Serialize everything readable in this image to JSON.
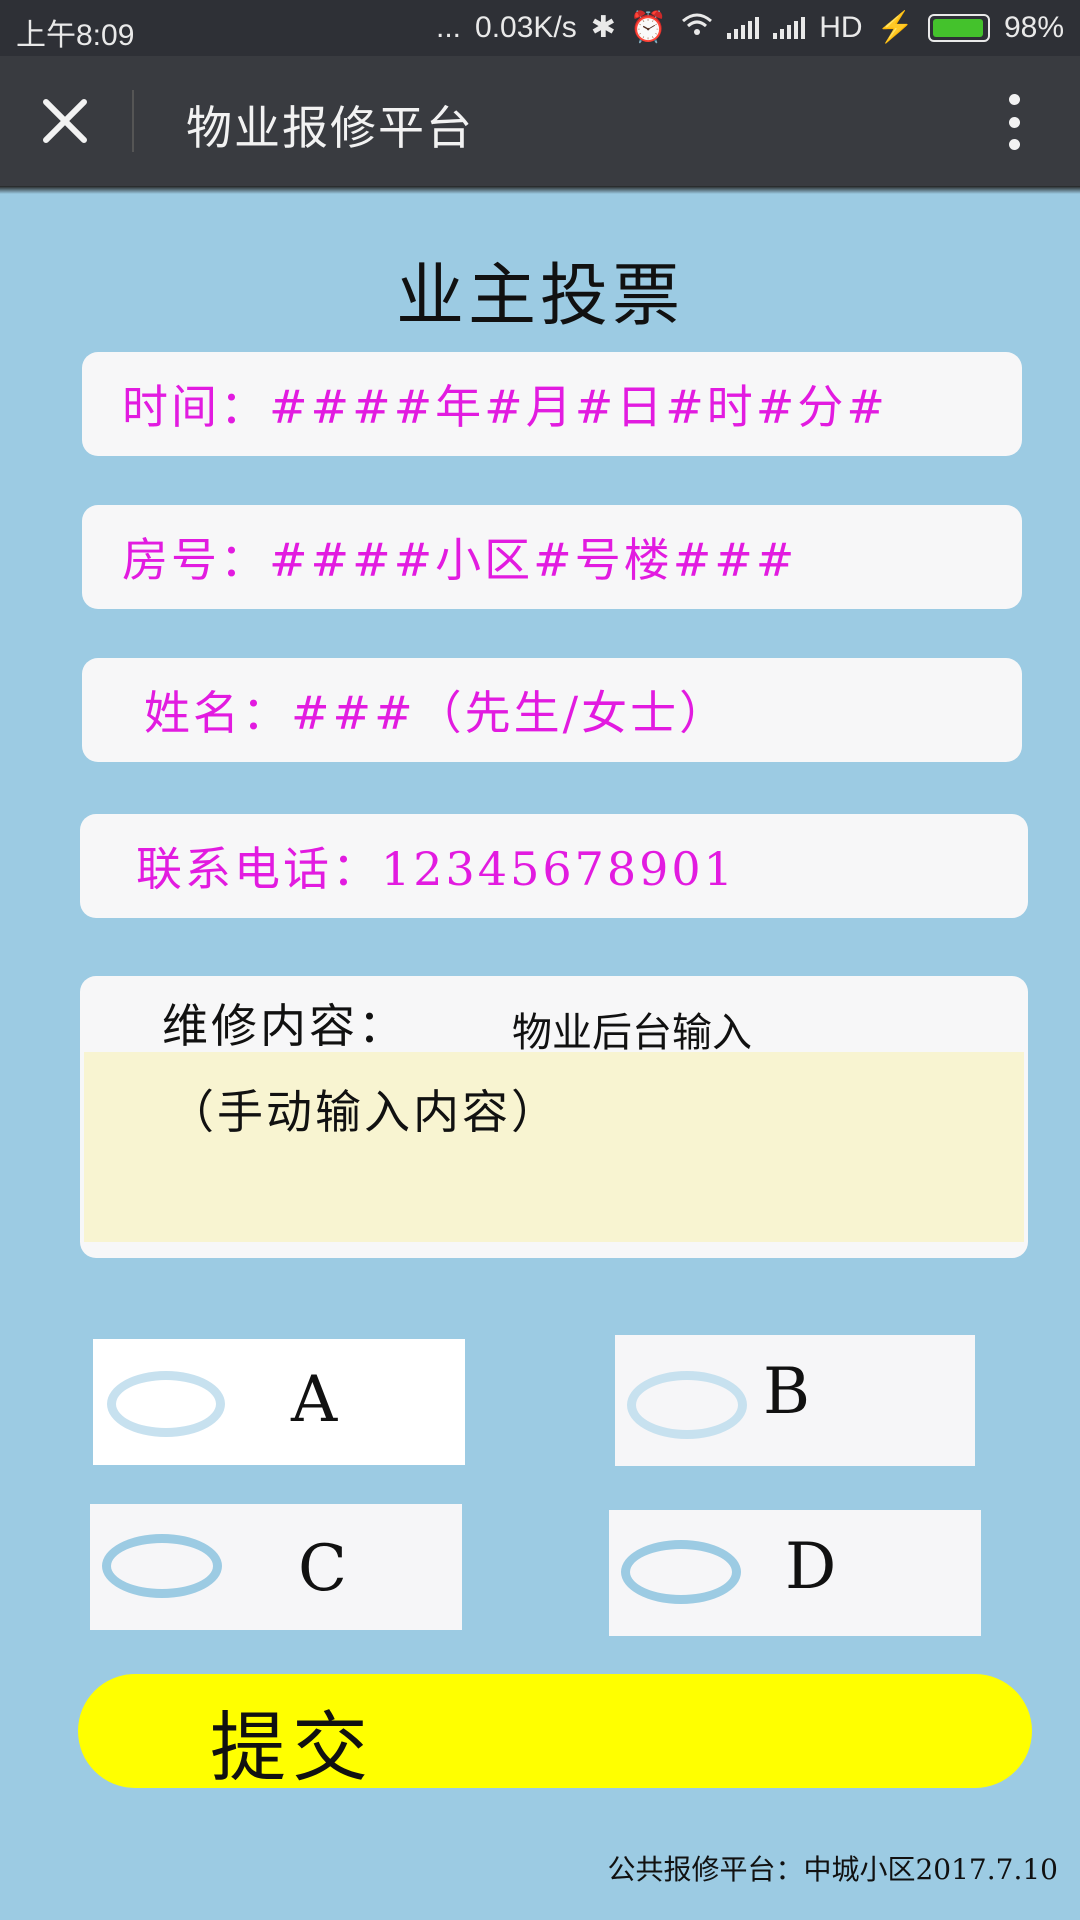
{
  "status_bar": {
    "time": "上午8:09",
    "dots": "...",
    "speed": "0.03K/s",
    "hd": "HD",
    "battery": "98%",
    "battery_color": "#44c22c"
  },
  "nav": {
    "title": "物业报修平台"
  },
  "heading": "业主投票",
  "fields": {
    "time": "时间：####年#月#日#时#分#",
    "room": "房号：####小区#号楼###",
    "name": "姓名：###（先生/女士）",
    "phone": "联系电话：12345678901"
  },
  "repair": {
    "label": "维修内容：",
    "hint": "物业后台输入",
    "placeholder": "（手动输入内容）"
  },
  "options": [
    "A",
    "B",
    "C",
    "D"
  ],
  "submit_label": "提交",
  "footer": "公共报修平台：中城小区2017.7.10",
  "colors": {
    "background": "#9ccbe3",
    "field_text": "#e21be0",
    "submit": "#ffff00",
    "textarea": "#f8f4d1"
  }
}
